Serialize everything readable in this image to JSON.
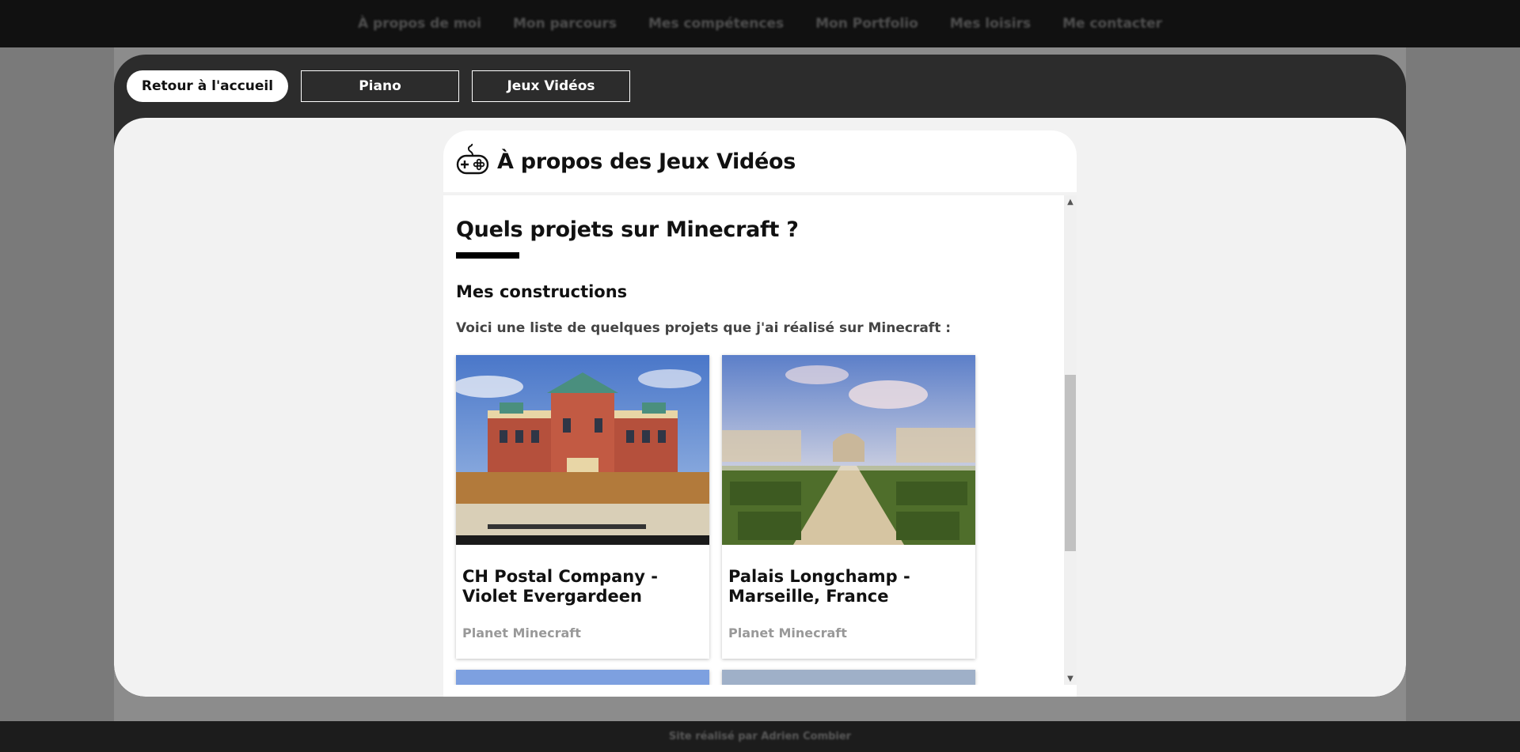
{
  "topnav": {
    "items": [
      "À propos de moi",
      "Mon parcours",
      "Mes compétences",
      "Mon Portfolio",
      "Mes loisirs",
      "Me contacter"
    ]
  },
  "modal": {
    "tabs": {
      "home": "Retour à l'accueil",
      "piano": "Piano",
      "games": "Jeux Vidéos"
    },
    "panel": {
      "icon": "gamepad-icon",
      "title": "À propos des Jeux Vidéos",
      "section_title": "Quels projets sur Minecraft ?",
      "subsection_title": "Mes constructions",
      "intro": "Voici une liste de quelques projets que j'ai réalisé sur Minecraft :",
      "cards": [
        {
          "title": "CH Postal Company - Violet Evergardeen",
          "source": "Planet Minecraft"
        },
        {
          "title": "Palais Longchamp - Marseille, France",
          "source": "Planet Minecraft"
        }
      ]
    }
  },
  "footer": {
    "text": "Site réalisé par Adrien Combier"
  },
  "colors": {
    "topbar": "#111111",
    "modal_frame": "#2c2c2c",
    "modal_body": "#f2f2f2",
    "card_source": "#999999"
  }
}
